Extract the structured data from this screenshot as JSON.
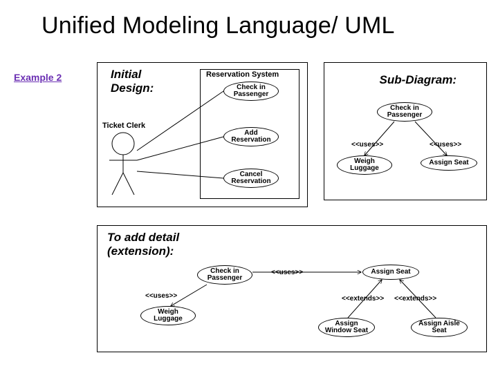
{
  "title": "Unified Modeling Language/ UML",
  "example_link": "Example 2",
  "labels": {
    "initial": "Initial\nDesign:",
    "subdiagram": "Sub-Diagram:",
    "extension": "To add detail\n(extension):"
  },
  "system_title": "Reservation System",
  "actor": "Ticket Clerk",
  "usecases": {
    "checkin": "Check in\nPassenger",
    "addres": "Add\nReservation",
    "cancel": "Cancel\nReservation",
    "weigh": "Weigh\nLuggage",
    "assign": "Assign Seat",
    "assign_window": "Assign\nWindow Seat",
    "assign_aisle": "Assign Aisle\nSeat"
  },
  "stereo": {
    "uses": "<<uses>>",
    "extends": "<<extends>>"
  }
}
